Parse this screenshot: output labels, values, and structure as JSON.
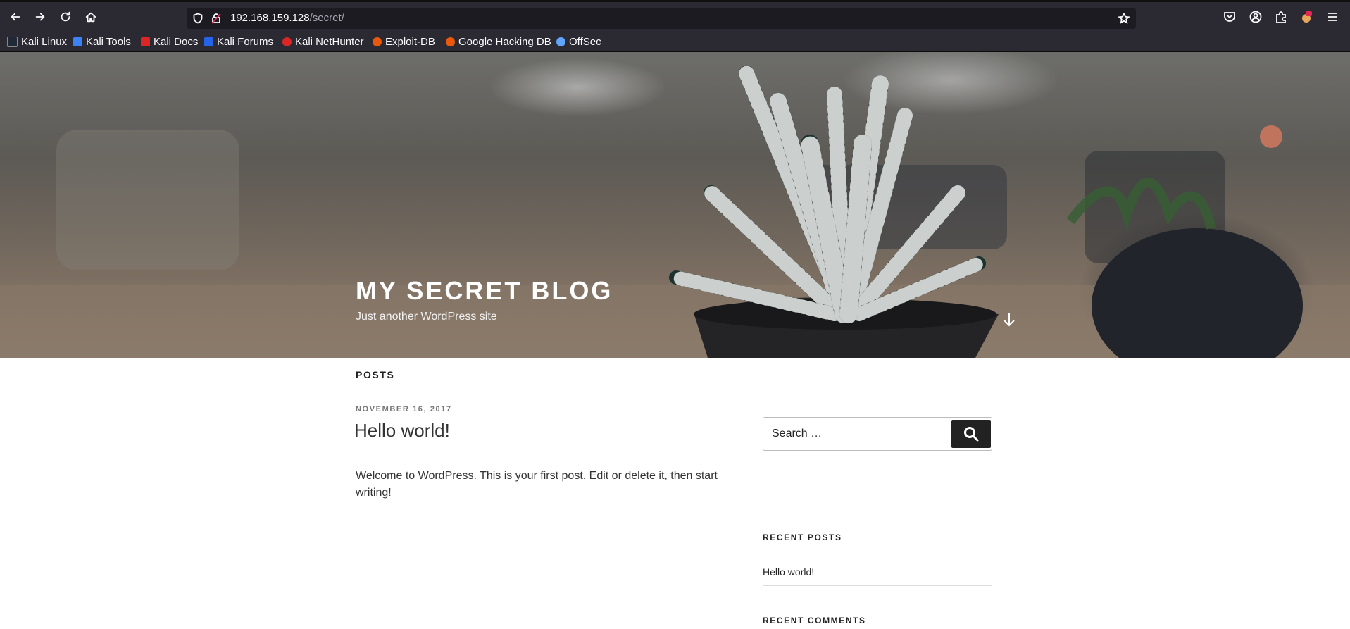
{
  "browser": {
    "url_host": "192.168.159.128",
    "url_path": "/secret/",
    "bookmarks": [
      {
        "label": "Kali Linux",
        "color": "#1f2937"
      },
      {
        "label": "Kali Tools",
        "color": "#3b82f6"
      },
      {
        "label": "Kali Docs",
        "color": "#dc2626"
      },
      {
        "label": "Kali Forums",
        "color": "#2563eb"
      },
      {
        "label": "Kali NetHunter",
        "color": "#dc2626"
      },
      {
        "label": "Exploit-DB",
        "color": "#ea580c"
      },
      {
        "label": "Google Hacking DB",
        "color": "#ea580c"
      },
      {
        "label": "OffSec",
        "color": "#60a5fa"
      }
    ]
  },
  "site": {
    "title": "MY SECRET BLOG",
    "description": "Just another WordPress site"
  },
  "main": {
    "posts_heading": "POSTS",
    "post": {
      "date": "NOVEMBER 16, 2017",
      "title": "Hello world!",
      "body": "Welcome to WordPress. This is your first post. Edit or delete it, then start writing!"
    }
  },
  "sidebar": {
    "search_placeholder": "Search …",
    "recent_posts_title": "RECENT POSTS",
    "recent_posts": [
      "Hello world!"
    ],
    "recent_comments_title": "RECENT COMMENTS"
  }
}
